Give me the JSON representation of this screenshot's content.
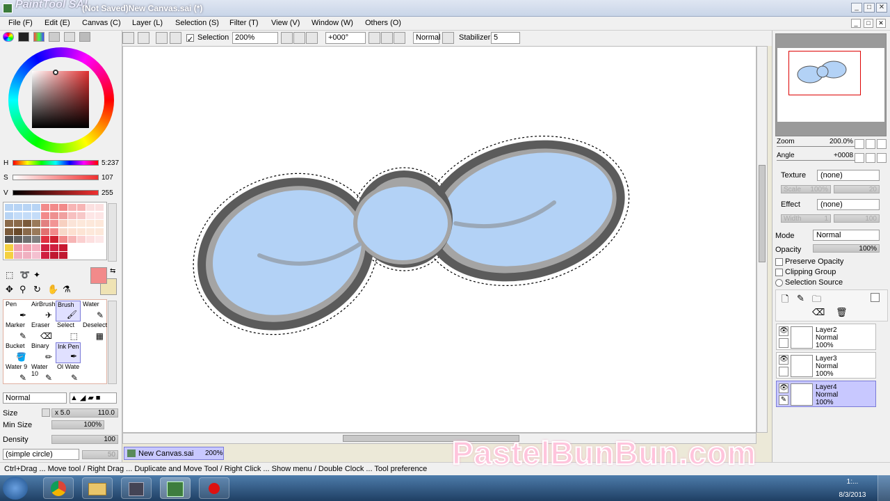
{
  "window": {
    "app_logo": "PaintTool SAI",
    "title": "(Not Saved)New Canvas.sai (*)"
  },
  "menu": [
    "File (F)",
    "Edit (E)",
    "Canvas (C)",
    "Layer (L)",
    "Selection (S)",
    "Filter (T)",
    "View (V)",
    "Window (W)",
    "Others (O)"
  ],
  "toolbar": {
    "selection_label": "Selection",
    "zoom_value": "200%",
    "angle_value": "+000°",
    "blend_value": "Normal",
    "stabilizer_label": "Stabilizer",
    "stabilizer_value": "5"
  },
  "color": {
    "h_label": "H",
    "h_value": "5:237",
    "s_label": "S",
    "s_value": "107",
    "v_label": "V",
    "v_value": "255",
    "primary": "#f28a8a",
    "secondary": "#efe3b4"
  },
  "tools": [
    {
      "label": "Pen",
      "icon": "pen-icon"
    },
    {
      "label": "AirBrush",
      "icon": "airbrush-icon"
    },
    {
      "label": "Brush",
      "icon": "brush-icon"
    },
    {
      "label": "Water",
      "icon": "water-icon"
    },
    {
      "label": "Marker",
      "icon": "marker-icon"
    },
    {
      "label": "Eraser",
      "icon": "eraser-icon"
    },
    {
      "label": "Select",
      "icon": "select-icon"
    },
    {
      "label": "Deselect",
      "icon": "deselect-icon"
    },
    {
      "label": "Bucket",
      "icon": "bucket-icon"
    },
    {
      "label": "Binary",
      "icon": "binary-icon"
    },
    {
      "label": "Ink Pen",
      "icon": "ink-pen-icon"
    },
    {
      "label": "",
      "icon": ""
    },
    {
      "label": "Water 9",
      "icon": "water-icon"
    },
    {
      "label": "Water 10",
      "icon": "water-icon"
    },
    {
      "label": "Ol Wate",
      "icon": "oil-water-icon"
    },
    {
      "label": "",
      "icon": ""
    }
  ],
  "brush": {
    "blend_mode": "Normal",
    "size_label": "Size",
    "size_mult": "x 5.0",
    "size_value": "110.0",
    "min_size_label": "Min Size",
    "min_size_value": "100%",
    "density_label": "Density",
    "density_value": "100",
    "shape": "(simple circle)",
    "shape_value": "50"
  },
  "navigator": {
    "zoom_label": "Zoom",
    "zoom_value": "200.0%",
    "angle_label": "Angle",
    "angle_value": "+0008"
  },
  "layer_props": {
    "texture_label": "Texture",
    "texture_value": "(none)",
    "scale_label": "Scale",
    "scale_value": "100%",
    "scale_num": "20",
    "effect_label": "Effect",
    "effect_value": "(none)",
    "width_label": "Width",
    "width_value": "1",
    "width_num": "100",
    "mode_label": "Mode",
    "mode_value": "Normal",
    "opacity_label": "Opacity",
    "opacity_value": "100%",
    "preserve_opacity": "Preserve Opacity",
    "clipping_group": "Clipping Group",
    "selection_source": "Selection Source"
  },
  "layers": [
    {
      "name": "Layer2",
      "mode": "Normal",
      "opacity": "100%"
    },
    {
      "name": "Layer3",
      "mode": "Normal",
      "opacity": "100%"
    },
    {
      "name": "Layer4",
      "mode": "Normal",
      "opacity": "100%"
    }
  ],
  "document_tab": {
    "name": "New Canvas.sai",
    "zoom": "200%"
  },
  "status_text": "Ctrl+Drag ... Move tool / Right Drag ... Duplicate and Move Tool / Right Click ... Show menu / Double Clock ... Tool preference",
  "watermark": "PastelBunBun.com",
  "clock": {
    "time": "1:...",
    "date": "8/3/2013"
  }
}
